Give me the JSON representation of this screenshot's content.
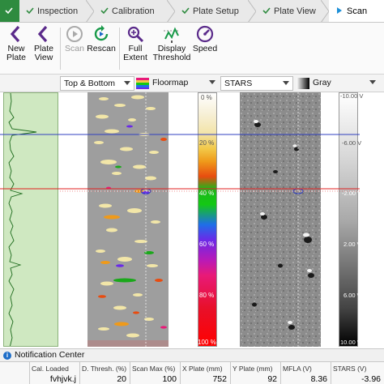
{
  "tabs": [
    {
      "label": ""
    },
    {
      "label": "Inspection"
    },
    {
      "label": "Calibration"
    },
    {
      "label": "Plate Setup"
    },
    {
      "label": "Plate View"
    },
    {
      "label": "Scan"
    }
  ],
  "toolbar": {
    "new_plate_l1": "New",
    "new_plate_l2": "Plate",
    "plate_view_l1": "Plate",
    "plate_view_l2": "View",
    "scan": "Scan",
    "rescan": "Rescan",
    "full_extent_l1": "Full",
    "full_extent_l2": "Extent",
    "display_threshold_l1": "Display",
    "display_threshold_l2": "Threshold",
    "speed": "Speed"
  },
  "viewbar": {
    "floor_select": "Top & Bottom",
    "floor_palette": "Floormap",
    "gray_select": "STARS",
    "gray_palette": "Gray"
  },
  "floorscale": [
    "0 %",
    "20 %",
    "40 %",
    "60 %",
    "80 %",
    "100 %"
  ],
  "grayscale": [
    "-10.00 V",
    "-6.00 V",
    "-2.00 V",
    "2.00 V",
    "6.00 V",
    "10.00 V"
  ],
  "notification": {
    "title": "Notification Center"
  },
  "status": [
    {
      "header": "Cal. Loaded",
      "value": "fvhjvk.j"
    },
    {
      "header": "D. Thresh. (%)",
      "value": "20"
    },
    {
      "header": "Scan Max (%)",
      "value": "100"
    },
    {
      "header": "X Plate (mm)",
      "value": "752"
    },
    {
      "header": "Y Plate (mm)",
      "value": "92"
    },
    {
      "header": "MFLA (V)",
      "value": "8.36"
    },
    {
      "header": "STARS (V)",
      "value": "-3.96"
    }
  ],
  "colors": {
    "accent_green": "#2e8b3f",
    "trace_background": "#cfe8c1",
    "cursor_red": "#e02020",
    "cursor_blue": "#3040c0"
  }
}
